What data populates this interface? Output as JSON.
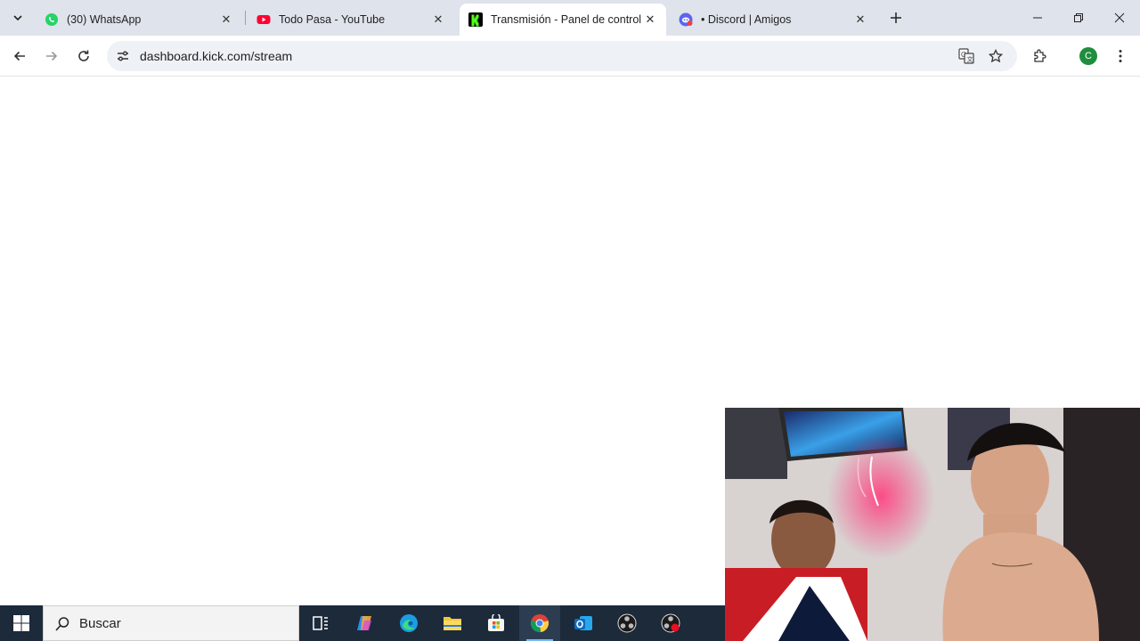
{
  "browser": {
    "tabs": [
      {
        "title": "(30) WhatsApp",
        "icon": "whatsapp-icon",
        "active": false
      },
      {
        "title": "Todo Pasa - YouTube",
        "icon": "youtube-icon",
        "active": false
      },
      {
        "title": "Transmisión - Panel de control de",
        "icon": "kick-icon",
        "active": true
      },
      {
        "title": "• Discord | Amigos",
        "icon": "discord-icon",
        "active": false
      }
    ],
    "url": "dashboard.kick.com/stream",
    "profile_initial": "C"
  },
  "taskbar": {
    "search_label": "Buscar",
    "apps": [
      "task-view-icon",
      "copilot-icon",
      "edge-icon",
      "file-explorer-icon",
      "microsoft-store-icon",
      "chrome-icon",
      "outlook-icon",
      "obs-icon",
      "obs-recording-icon"
    ]
  },
  "colors": {
    "tabstrip": "#dfe3eb",
    "omnibox": "#eef1f6",
    "taskbar": "#1c2a3a",
    "kick_green": "#53fc18",
    "profile_green": "#1e8e3e"
  }
}
